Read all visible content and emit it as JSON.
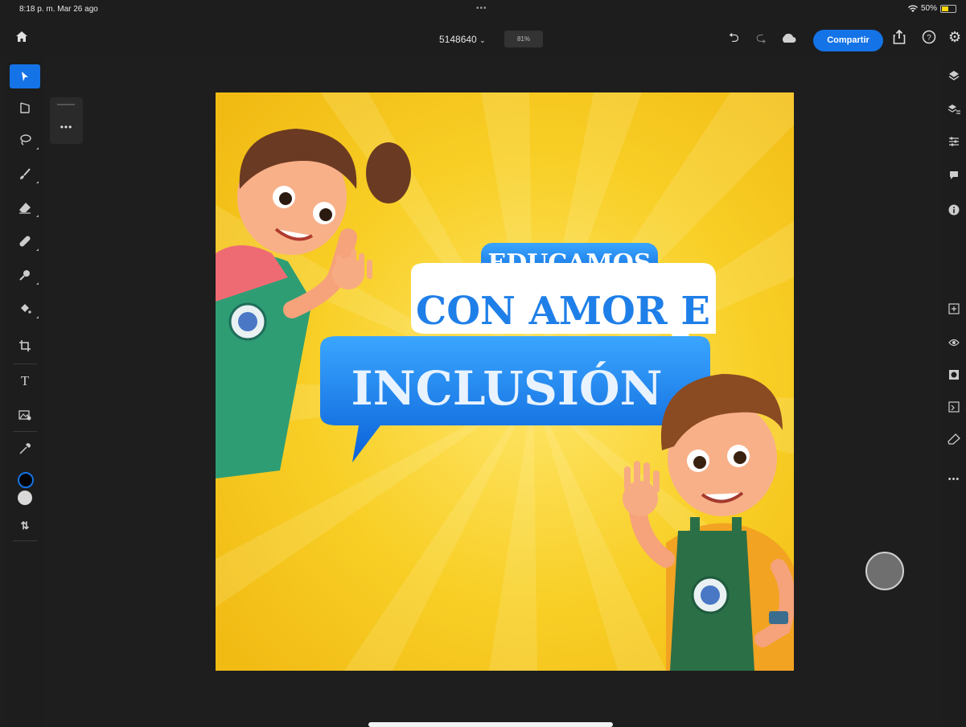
{
  "status_bar": {
    "time": "8:18 p. m.  Mar 26 ago",
    "multitask_dots": "•••",
    "wifi_battery": "50%"
  },
  "toolbar": {
    "document_name": "5148640",
    "zoom": "81%",
    "share_label": "Compartir"
  },
  "floating_panel": {
    "more": "•••"
  },
  "right_panel": {
    "more": "•••"
  },
  "artwork": {
    "line1": "EDUCAMOS",
    "line2": "CON AMOR E",
    "line3": "INCLUSIÓN"
  },
  "colors": {
    "accent": "#1473e6",
    "canvas_bg": "#f6c61a",
    "foreground_swatch": "#000000",
    "background_swatch": "#d9d9d9"
  }
}
